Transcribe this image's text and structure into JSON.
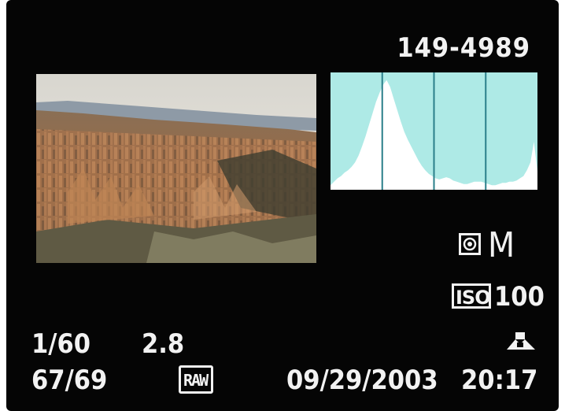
{
  "image_info": {
    "file_number": "149-4989",
    "shutter_speed": "1/60",
    "aperture": "2.8",
    "frame_counter": "67/69",
    "quality": "RAW",
    "date": "09/29/2003",
    "time": "20:17"
  },
  "exposure": {
    "metering_icon": "evaluative-metering-icon",
    "mode": "M",
    "iso_label": "ISO",
    "iso_value": "100",
    "white_balance_icon": "custom-white-balance-icon"
  },
  "histogram": {
    "fill_color": "#ffffff",
    "background_color": "#aeeae6",
    "gridline_color": "#2a7f8a",
    "gridline_count": 3,
    "levels": [
      0.04,
      0.07,
      0.1,
      0.12,
      0.15,
      0.17,
      0.2,
      0.24,
      0.3,
      0.38,
      0.47,
      0.57,
      0.67,
      0.77,
      0.85,
      0.92,
      0.96,
      0.9,
      0.8,
      0.7,
      0.6,
      0.51,
      0.44,
      0.38,
      0.32,
      0.26,
      0.21,
      0.17,
      0.14,
      0.12,
      0.1,
      0.09,
      0.1,
      0.11,
      0.1,
      0.08,
      0.07,
      0.06,
      0.05,
      0.05,
      0.06,
      0.07,
      0.07,
      0.07,
      0.06,
      0.05,
      0.04,
      0.04,
      0.05,
      0.06,
      0.06,
      0.07,
      0.07,
      0.08,
      0.1,
      0.12,
      0.17,
      0.24,
      0.42,
      0.16
    ]
  },
  "colors": {
    "screen_background": "#050505",
    "text": "#f2f2f2"
  }
}
